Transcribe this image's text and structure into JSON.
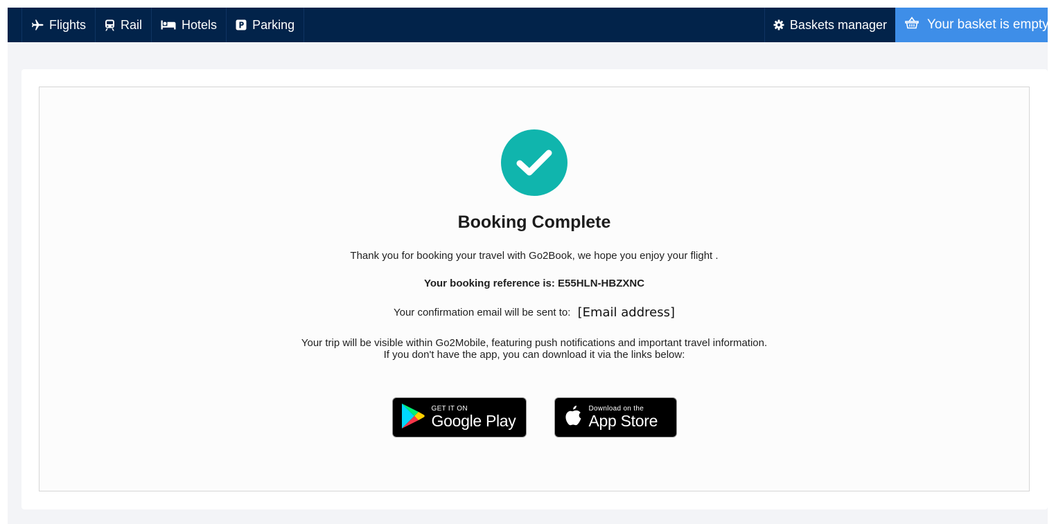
{
  "nav": {
    "items": [
      {
        "label": "Flights",
        "icon": "plane-icon"
      },
      {
        "label": "Rail",
        "icon": "train-icon"
      },
      {
        "label": "Hotels",
        "icon": "bed-icon"
      },
      {
        "label": "Parking",
        "icon": "parking-icon"
      }
    ],
    "baskets_manager": {
      "label": "Baskets manager",
      "icon": "gear-icon"
    },
    "basket": {
      "label": "Your basket is empty",
      "icon": "basket-icon"
    }
  },
  "confirmation": {
    "icon": "check-circle-icon",
    "title": "Booking Complete",
    "thank_you": "Thank you for booking your travel with Go2Book, we hope you enjoy your flight .",
    "reference_text": "Your booking reference is: E55HLN-HBZXNC",
    "email_label": "Your confirmation email will be sent to:",
    "email_value": "[Email address]",
    "app_line1": "Your trip will be visible within Go2Mobile, featuring push notifications and important travel information.",
    "app_line2": "If you don't have the app, you can download it via the links below:"
  },
  "badges": {
    "google_play": {
      "small": "GET IT ON",
      "big": "Google Play",
      "icon": "google-play-icon"
    },
    "app_store": {
      "small": "Download on the",
      "big": "App Store",
      "icon": "apple-icon"
    }
  },
  "colors": {
    "nav_bg": "#02234a",
    "basket_bg": "#3e8ee8",
    "success": "#10b5ad"
  }
}
